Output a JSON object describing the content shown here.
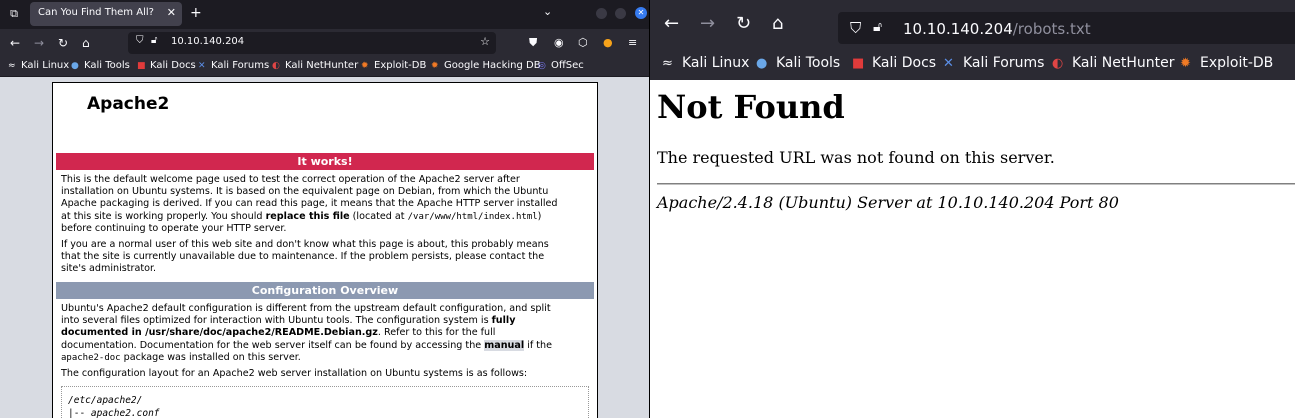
{
  "left_browser": {
    "tab": {
      "title": "Can You Find Them All?",
      "close": "✕"
    },
    "tab_list_icon": "⧉",
    "new_tab": "+",
    "tab_overflow": "⌄",
    "url": "10.10.140.204",
    "bookmarks": [
      {
        "label": "Kali Linux",
        "icon": "kali-icon"
      },
      {
        "label": "Kali Tools",
        "icon": "kali-tools-icon"
      },
      {
        "label": "Kali Docs",
        "icon": "kali-docs-icon"
      },
      {
        "label": "Kali Forums",
        "icon": "kali-forums-icon"
      },
      {
        "label": "Kali NetHunter",
        "icon": "nethunter-icon"
      },
      {
        "label": "Exploit-DB",
        "icon": "exploitdb-icon"
      },
      {
        "label": "Google Hacking DB",
        "icon": "ghdb-icon"
      },
      {
        "label": "OffSec",
        "icon": "offsec-icon"
      }
    ],
    "page": {
      "title": "Apache2",
      "section1": "It works!",
      "p1_a": "This is the default welcome page used to test the correct operation of the Apache2 server after",
      "p1_b": "installation on Ubuntu systems. It is based on the equivalent page on Debian, from which the Ubuntu",
      "p1_c": "Apache packaging is derived. If you can read this page, it means that the Apache HTTP server installed",
      "p1_d1": "at this site is working properly. You should ",
      "p1_d2": "replace this file",
      "p1_d3": " (located at ",
      "p1_d4": "/var/www/html/index.html",
      "p1_d5": ")",
      "p1_e": "before continuing to operate your HTTP server.",
      "p2_a": "If you are a normal user of this web site and don't know what this page is about, this probably means",
      "p2_b": "that the site is currently unavailable due to maintenance. If the problem persists, please contact the",
      "p2_c": "site's administrator.",
      "section2": "Configuration Overview",
      "p3_a": "Ubuntu's Apache2 default configuration is different from the upstream default configuration, and split",
      "p3_b1": "into several files optimized for interaction with Ubuntu tools. The configuration system is ",
      "p3_b2": "fully",
      "p3_c1": "documented in /usr/share/doc/apache2/README.Debian.gz",
      "p3_c2": ". Refer to this for the full",
      "p3_d1": "documentation. Documentation for the web server itself can be found by accessing the ",
      "p3_d2": "manual",
      "p3_d3": " if the",
      "p3_e1": "apache2-doc",
      "p3_e2": " package was installed on this server.",
      "p4": "The configuration layout for an Apache2 web server installation on Ubuntu systems is as follows:",
      "code1": "/etc/apache2/",
      "code2a": "|-- ",
      "code2b": "apache2.conf"
    }
  },
  "right_browser": {
    "url_host": "10.10.140.204",
    "url_path": "/robots.txt",
    "bookmarks": [
      {
        "label": "Kali Linux",
        "icon": "kali-icon"
      },
      {
        "label": "Kali Tools",
        "icon": "kali-tools-icon"
      },
      {
        "label": "Kali Docs",
        "icon": "kali-docs-icon"
      },
      {
        "label": "Kali Forums",
        "icon": "kali-forums-icon"
      },
      {
        "label": "Kali NetHunter",
        "icon": "nethunter-icon"
      },
      {
        "label": "Exploit-DB",
        "icon": "exploitdb-icon"
      }
    ],
    "page": {
      "title": "Not Found",
      "message": "The requested URL was not found on this server.",
      "address": "Apache/2.4.18 (Ubuntu) Server at 10.10.140.204 Port 80"
    }
  },
  "colors": {
    "apache_red": "#d1274f",
    "apache_gray": "#8c99b1",
    "browser_chrome": "#2b2a33",
    "accent_blue": "#367bf0"
  }
}
